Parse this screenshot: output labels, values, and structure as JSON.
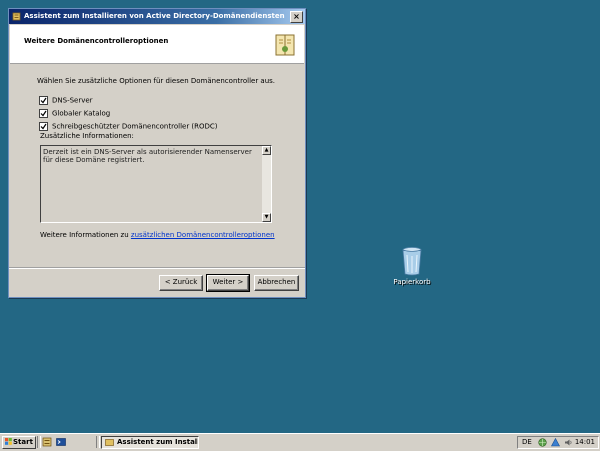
{
  "window": {
    "title": "Assistent zum Installieren von Active Directory-Domänendiensten",
    "close_label": "×",
    "header_title": "Weitere Domänencontrolleroptionen",
    "header_icon": "directory-book-icon"
  },
  "content": {
    "intro": "Wählen Sie zusätzliche Optionen für diesen Domänencontroller aus.",
    "checkboxes": [
      {
        "label": "DNS-Server",
        "checked": true
      },
      {
        "label": "Globaler Katalog",
        "checked": true
      },
      {
        "label": "Schreibgeschützter Domänencontroller (RODC)",
        "checked": true
      }
    ],
    "info_label": "Zusätzliche Informationen:",
    "info_text": "Derzeit ist ein DNS-Server als autorisierender Namenserver für diese Domäne registriert.",
    "more_info_prefix": "Weitere Informationen zu ",
    "more_info_link": "zusätzlichen Domänencontrolleroptionen"
  },
  "buttons": {
    "back": "< Zurück",
    "next": "Weiter >",
    "cancel": "Abbrechen"
  },
  "desktop": {
    "recycle_bin_label": "Papierkorb"
  },
  "taskbar": {
    "start_label": "Start",
    "task_label": "Assistent zum Installi...",
    "language": "DE",
    "clock": "14:01"
  },
  "colors": {
    "desktop": "#236784",
    "titlebar": "#0a246a",
    "link": "#0033cc"
  }
}
